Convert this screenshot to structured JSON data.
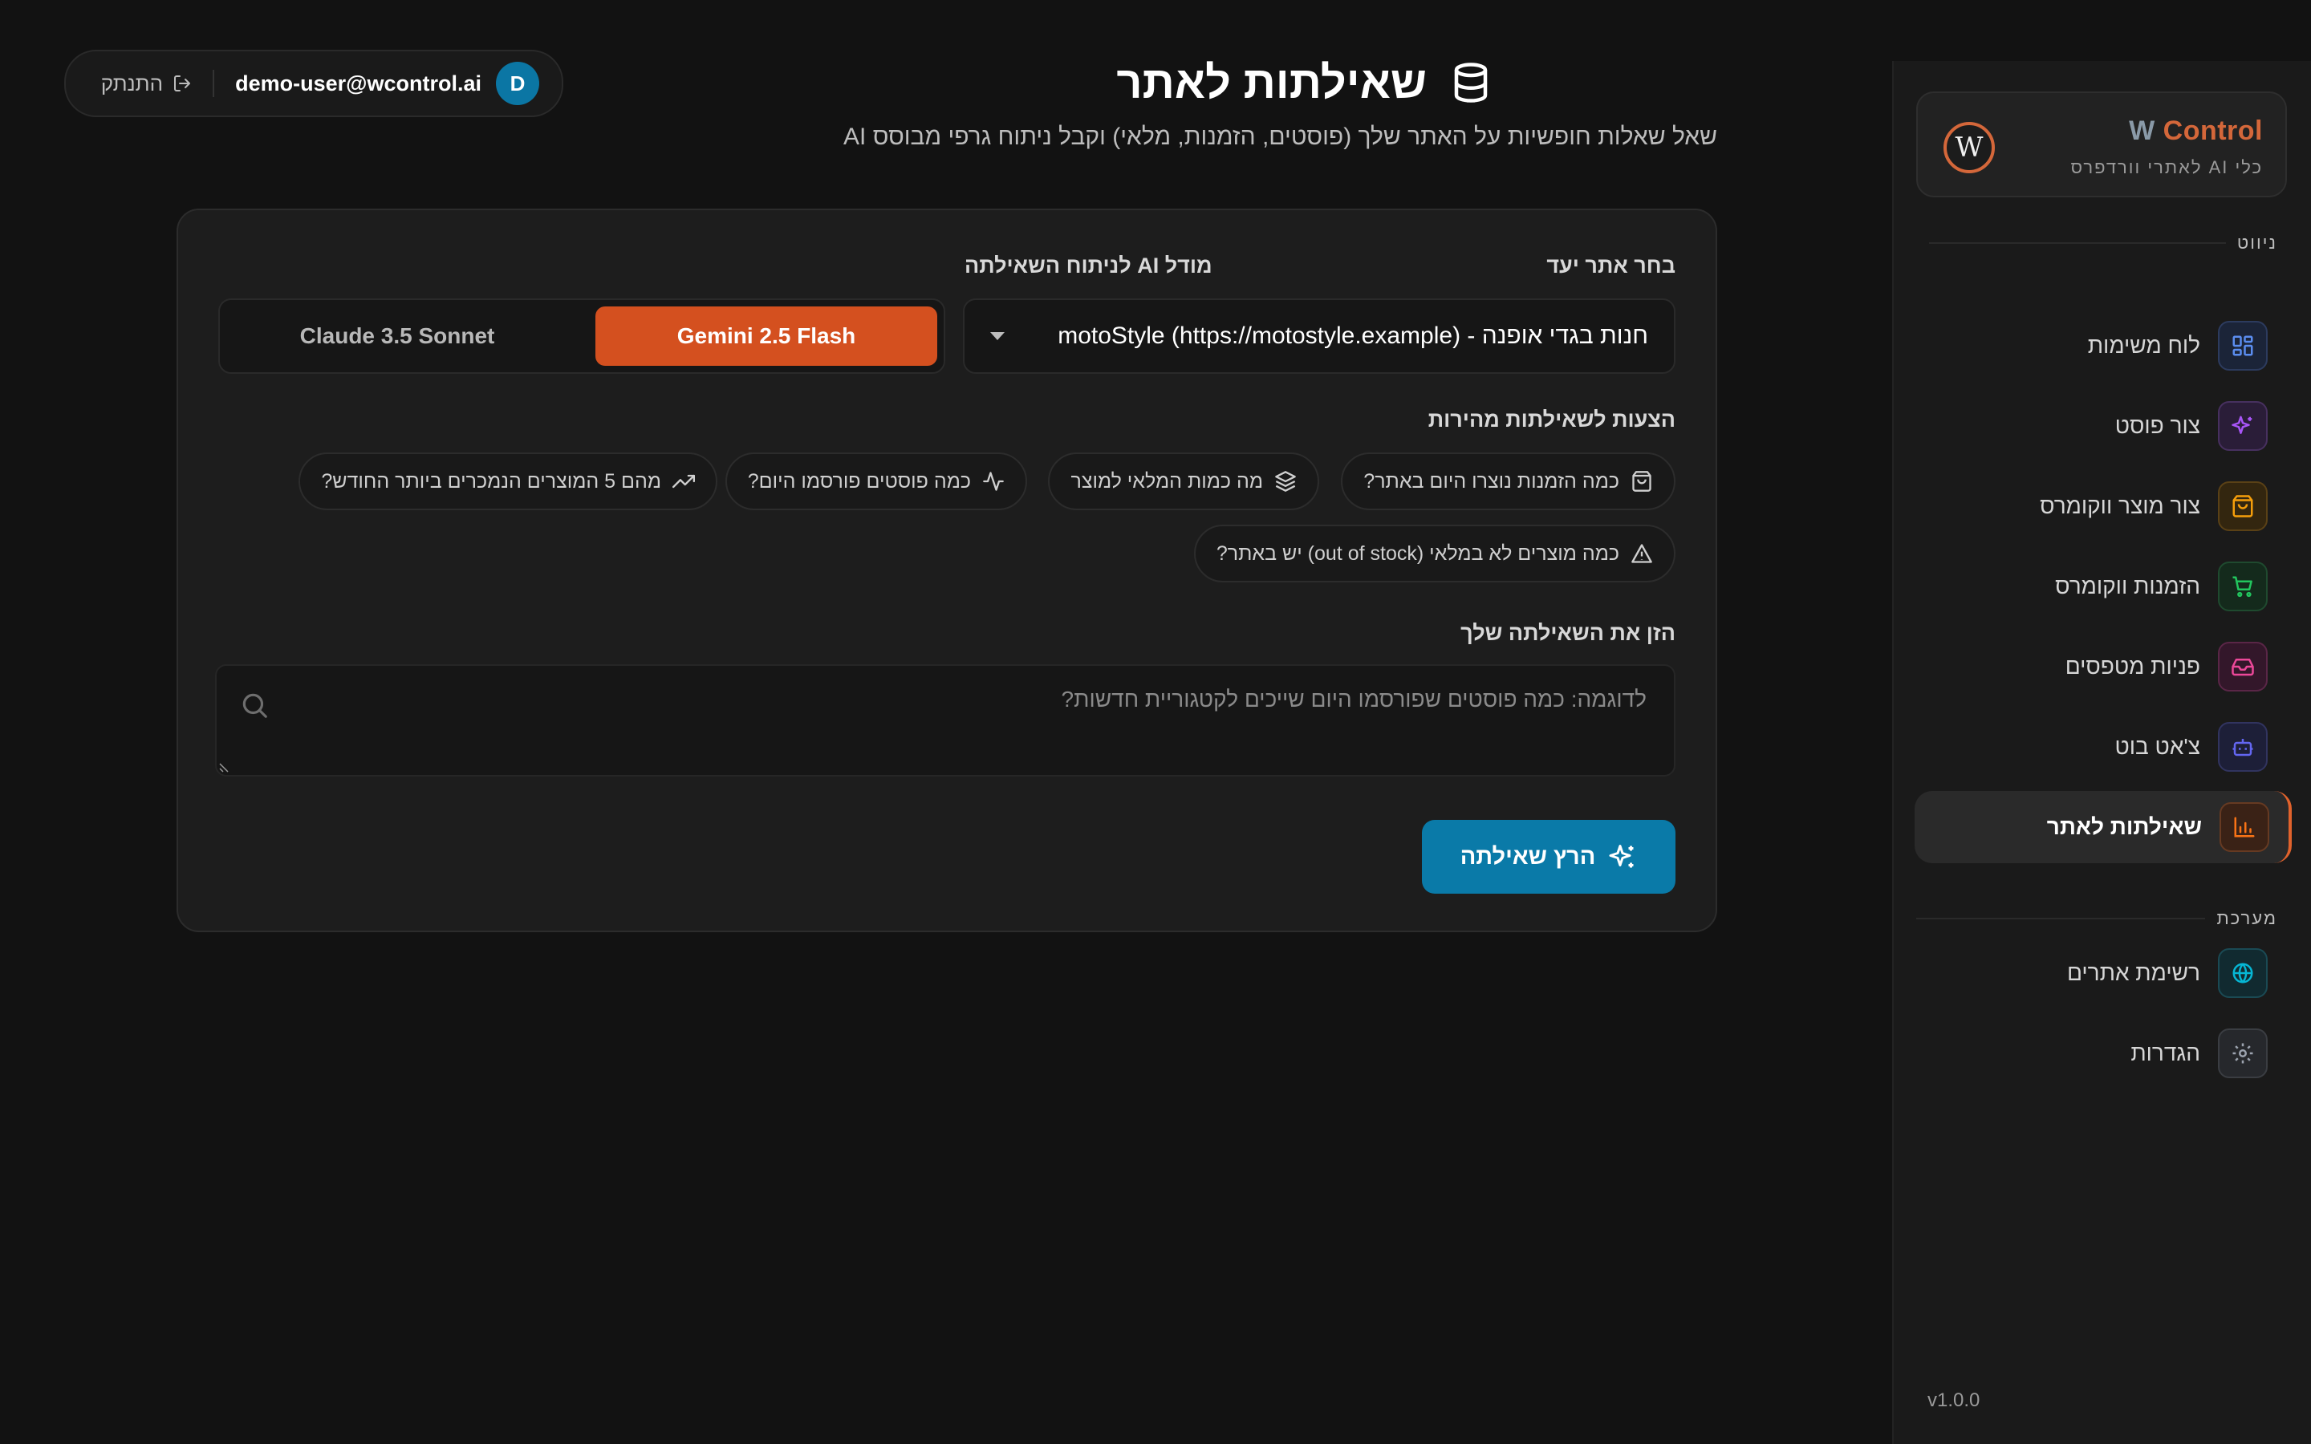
{
  "sidebar": {
    "brand_title_w": "W",
    "brand_title_rest": " Control",
    "brand_subtitle": "כלי AI לאתרי וורדפרס",
    "logo_letter": "W",
    "section_nav": "ניווט",
    "section_system": "מערכת",
    "items": [
      {
        "label": "לוח משימות",
        "icon": "dashboard-grid-icon",
        "color": "#5b8def"
      },
      {
        "label": "צור פוסט",
        "icon": "sparkles-icon",
        "color": "#a855f7"
      },
      {
        "label": "צור מוצר ווקומרס",
        "icon": "shopping-bag-icon",
        "color": "#f59e0b"
      },
      {
        "label": "הזמנות ווקומרס",
        "icon": "cart-icon",
        "color": "#22c55e"
      },
      {
        "label": "פניות מטפסים",
        "icon": "inbox-icon",
        "color": "#ec4899"
      },
      {
        "label": "צ'אט בוט",
        "icon": "bot-icon",
        "color": "#6366f1"
      },
      {
        "label": "שאילתות לאתר",
        "icon": "bar-chart-icon",
        "color": "#f97316",
        "active": true
      }
    ],
    "system_items": [
      {
        "label": "רשימת אתרים",
        "icon": "globe-icon",
        "color": "#06b6d4"
      },
      {
        "label": "הגדרות",
        "icon": "settings-icon",
        "color": "#9ca3af"
      }
    ],
    "version": "v1.0.0"
  },
  "header": {
    "title": "שאילתות לאתר",
    "subtitle": "שאל שאלות חופשיות על האתר שלך (פוסטים, הזמנות, מלאי) וקבל ניתוח גרפי מבוסס AI",
    "user_initial": "D",
    "user_email": "demo-user@wcontrol.ai",
    "logout_label": "התנתק"
  },
  "form": {
    "site_label": "בחר אתר יעד",
    "site_value": "חנות בגדי אופנה - motoStyle (https://motostyle.example)",
    "model_label": "מודל AI לניתוח השאילתה",
    "models": [
      "Gemini 2.5 Flash",
      "Claude 3.5 Sonnet"
    ],
    "selected_model": "Gemini 2.5 Flash",
    "suggestions_label": "הצעות לשאילתות מהירות",
    "suggestions": [
      "כמה הזמנות נוצרו היום באתר?",
      "מה כמות המלאי למוצר",
      "כמה פוסטים פורסמו היום?",
      "מהם 5 המוצרים הנמכרים ביותר החודש?",
      "כמה מוצרים לא במלאי (out of stock) יש באתר?"
    ],
    "query_label": "הזן את השאילתה שלך",
    "query_placeholder": "לדוגמה: כמה פוסטים שפורסמו היום שייכים לקטגוריית חדשות?",
    "query_value": "",
    "run_label": "הרץ שאילתה"
  },
  "colors": {
    "accent": "#d4501f",
    "primary": "#0a7aa8",
    "background": "#121212"
  }
}
